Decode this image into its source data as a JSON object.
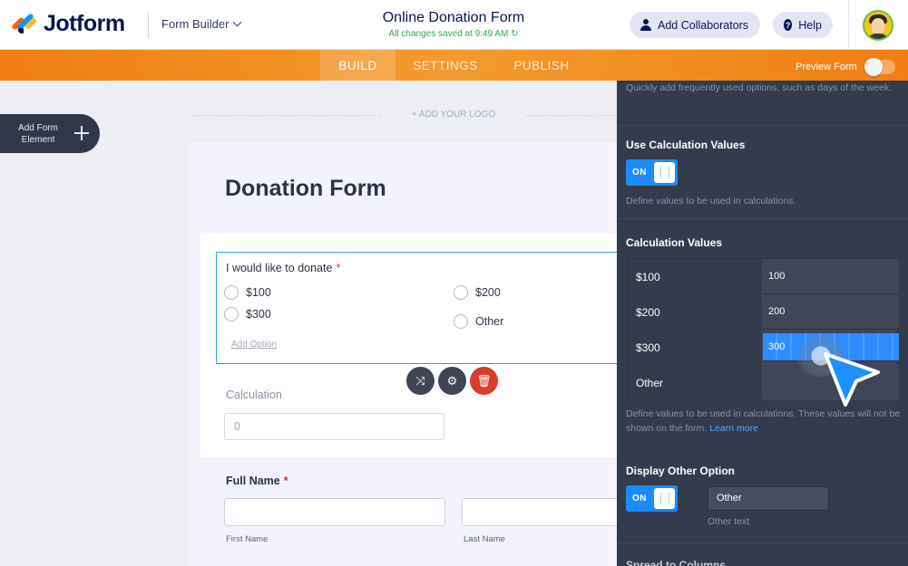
{
  "app": {
    "logo_text": "Jotform",
    "form_builder_label": "Form Builder",
    "form_title": "Online Donation Form",
    "saved_status": "All changes saved at 9:49 AM",
    "collaborators_label": "Add Collaborators",
    "help_label": "Help"
  },
  "nav": {
    "tabs": [
      "BUILD",
      "SETTINGS",
      "PUBLISH"
    ],
    "active_tab": "BUILD",
    "preview_label": "Preview Form"
  },
  "canvas": {
    "add_element_label": "Add Form Element",
    "add_logo_label": "+ ADD YOUR LOGO",
    "form_heading": "Donation Form",
    "question": {
      "label": "I would like to donate",
      "required_mark": "*",
      "options": [
        "$100",
        "$200",
        "$300",
        "Other"
      ],
      "add_option": "Add Option"
    },
    "calculation": {
      "label": "Calculation",
      "value": "0"
    },
    "full_name": {
      "label": "Full Name",
      "required_mark": "*",
      "first": "First Name",
      "last": "Last Name"
    }
  },
  "panel": {
    "intro_hint": "Quickly add frequently used options, such as days of the week.",
    "use_calc_heading": "Use Calculation Values",
    "toggle_on": "ON",
    "use_calc_hint": "Define values to be used in calculations.",
    "calc_values_heading": "Calculation Values",
    "calc_rows": [
      {
        "label": "$100",
        "value": "100"
      },
      {
        "label": "$200",
        "value": "200"
      },
      {
        "label": "$300",
        "value": "300"
      },
      {
        "label": "Other",
        "value": ""
      }
    ],
    "calc_values_hint": "Define values to be used in calculations. These values will not be shown on the form.",
    "learn_more": "Learn more",
    "display_other_heading": "Display Other Option",
    "other_text_value": "Other",
    "other_text_label": "Other text",
    "next_heading": "Spread to Columns"
  },
  "colors": {
    "accent": "#1a8cff",
    "nav_orange": "#f07f13",
    "panel_bg": "#333b4c",
    "required": "#d9302a",
    "delete": "#d73c2c"
  },
  "icons": [
    "person-icon",
    "help-icon",
    "plus-icon",
    "shuffle-icon",
    "gear-icon",
    "trash-icon",
    "pointer-cursor-icon"
  ]
}
